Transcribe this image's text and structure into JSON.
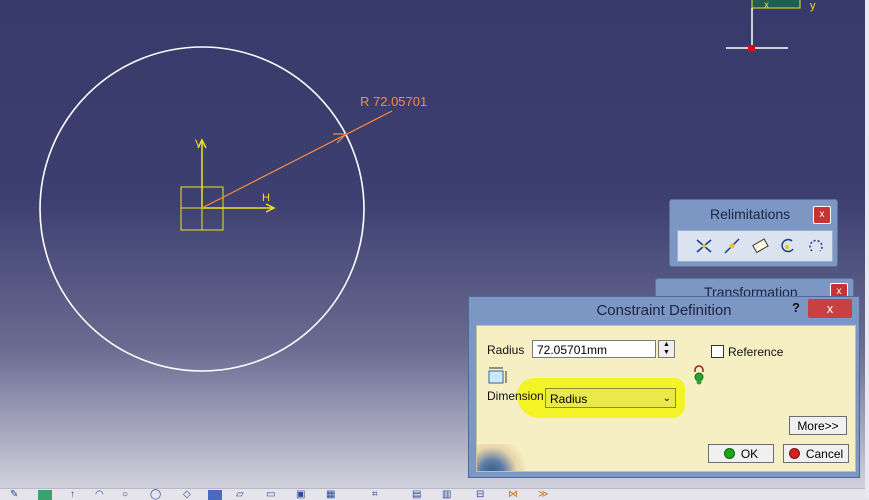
{
  "sketch": {
    "dimension_label": "R 72.05701",
    "h_axis_label": "H",
    "v_axis_label": "V",
    "compass_x_label": "x",
    "compass_y_label": "y",
    "colors": {
      "geometry": "#ffffff",
      "axes": "#f0e020",
      "dimension": "#ff8a3a"
    }
  },
  "relimitations_toolbar": {
    "title": "Relimitations",
    "close_label": "x",
    "icons": [
      "trim-icon",
      "break-icon",
      "quick-trim-icon",
      "close-arc-icon",
      "complement-icon"
    ]
  },
  "transformation_toolbar": {
    "title": "Transformation",
    "close_label": "x"
  },
  "constraint_dialog": {
    "title": "Constraint Definition",
    "help_label": "?",
    "close_label": "x",
    "radius_label": "Radius",
    "radius_value": "72.05701mm",
    "reference_label": "Reference",
    "reference_checked": false,
    "dimension_label": "Dimension",
    "dimension_value": "Radius",
    "more_label": "More>>",
    "ok_label": "OK",
    "cancel_label": "Cancel"
  }
}
